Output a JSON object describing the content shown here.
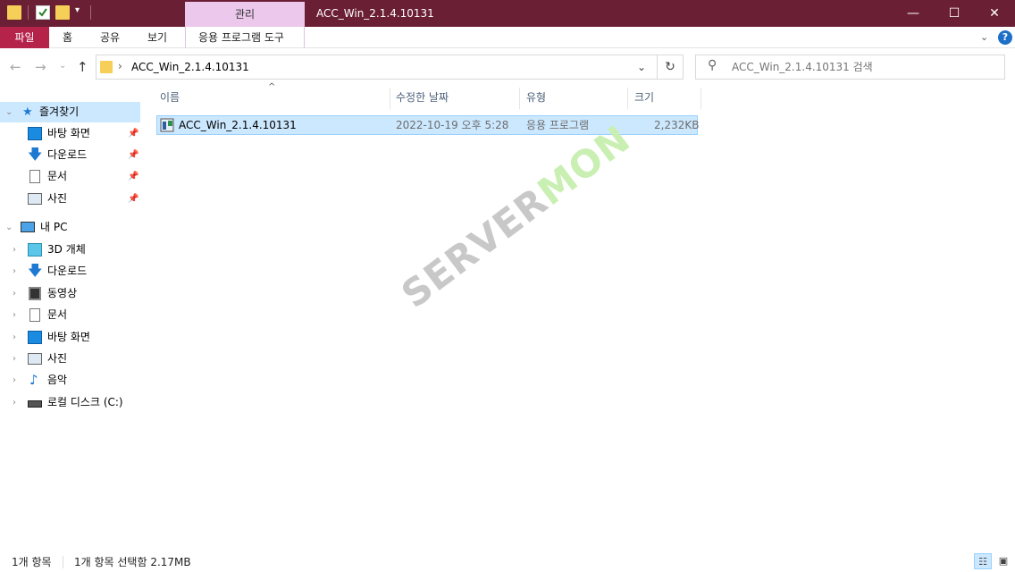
{
  "titlebar": {
    "manage_tab": "관리",
    "window_title": "ACC_Win_2.1.4.10131",
    "dropdown_glyph": "▾",
    "minimize_glyph": "—",
    "maximize_glyph": "☐",
    "close_glyph": "✕"
  },
  "ribbon": {
    "file": "파일",
    "home": "홈",
    "share": "공유",
    "view": "보기",
    "app_tools": "응용 프로그램 도구",
    "expand_glyph": "⌄",
    "help_glyph": "?"
  },
  "navbar": {
    "back_glyph": "←",
    "forward_glyph": "→",
    "recent_glyph": "⌄",
    "up_glyph": "↑",
    "separator": "›",
    "path": "ACC_Win_2.1.4.10131",
    "dropdown_glyph": "⌄",
    "refresh_glyph": "↻",
    "search_glyph": "⚲",
    "search_placeholder": "ACC_Win_2.1.4.10131 검색"
  },
  "navpane": {
    "expanded_glyph": "⌄",
    "collapsed_glyph": "›",
    "pin_glyph": "📌",
    "quick_access": "즐겨찾기",
    "qa_items": [
      "바탕 화면",
      "다운로드",
      "문서",
      "사진"
    ],
    "this_pc": "내 PC",
    "pc_items": [
      "3D 개체",
      "다운로드",
      "동영상",
      "문서",
      "바탕 화면",
      "사진",
      "음악",
      "로컬 디스크 (C:)"
    ]
  },
  "columns": {
    "name": "이름",
    "date": "수정한 날짜",
    "type": "유형",
    "size": "크기",
    "sort_glyph": "^"
  },
  "files": [
    {
      "name": "ACC_Win_2.1.4.10131",
      "date": "2022-10-19 오후 5:28",
      "type": "응용 프로그램",
      "size": "2,232KB"
    }
  ],
  "watermark": {
    "part1": "SERVER",
    "part2": "MON"
  },
  "status": {
    "count": "1개 항목",
    "selected": "1개 항목 선택함 2.17MB",
    "details_view_glyph": "☷",
    "large_icons_glyph": "▣"
  },
  "colors": {
    "titlebar_bg": "#6b1f35",
    "file_tab_bg": "#b5234b",
    "manage_tab_bg": "#ecc8ec",
    "selection_bg": "#cce8ff"
  }
}
